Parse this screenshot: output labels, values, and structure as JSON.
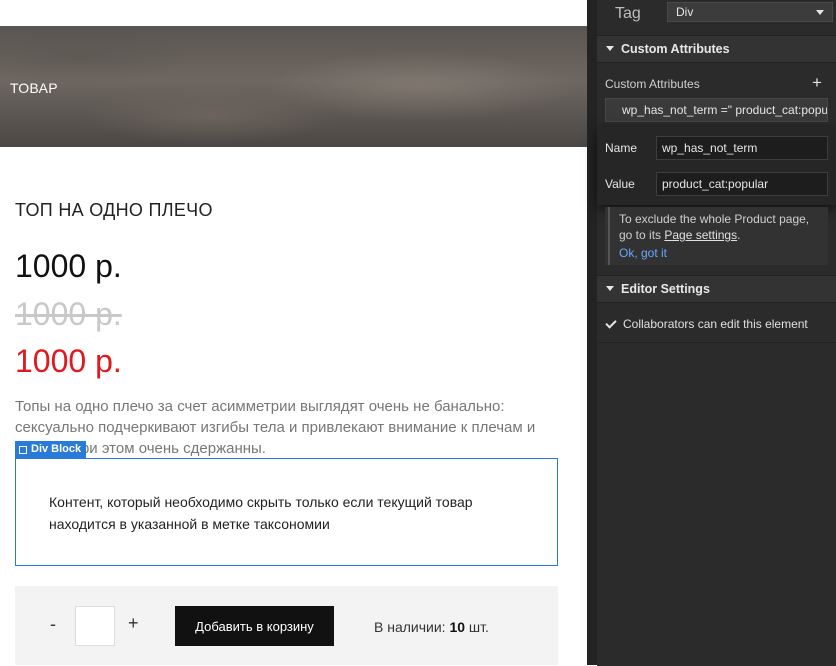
{
  "canvas": {
    "hero_title": "ТОВАР",
    "product_name": "ТОП НА ОДНО ПЛЕЧО",
    "price_current": "1000 р.",
    "price_old": "1000 р.",
    "price_sale": "1000 р.",
    "description": "Топы на одно плечо за счет асимметрии выглядят очень не банально: сексуально подчеркивают изгибы тела и привлекают внимание к плечам и шее, но при этом очень сдержанны.",
    "div_block_label": "Div Block",
    "hidden_content_text": "Контент, который необходимо скрыть только если текущий товар находится в указанной в метке таксономии",
    "qty_minus": "-",
    "qty_plus": "+",
    "add_to_cart_label": "Добавить в корзину",
    "stock_label": "В наличии:",
    "stock_count": "10",
    "stock_unit": "шт."
  },
  "panel": {
    "tag_label": "Tag",
    "tag_value": "Div",
    "custom_attributes_header": "Custom Attributes",
    "custom_attributes_label": "Custom Attributes",
    "add_icon": "+",
    "attribute_summary": "wp_has_not_term =\" product_cat:popular\"",
    "name_label": "Name",
    "name_value": "wp_has_not_term",
    "value_label": "Value",
    "value_value": "product_cat:popular",
    "info_text_1": "To exclude the whole Product page, go to its",
    "info_link": "Page settings",
    "info_text_2": ".",
    "info_ok": "Ok, got it",
    "editor_settings_header": "Editor Settings",
    "collaborators_label": "Collaborators can edit this element",
    "collaborators_checked": true
  },
  "colors": {
    "accent_blue": "#2a7ad8",
    "sale_red": "#e0191f",
    "panel_bg": "#2b2b2b",
    "link_blue": "#6aa7ff"
  }
}
